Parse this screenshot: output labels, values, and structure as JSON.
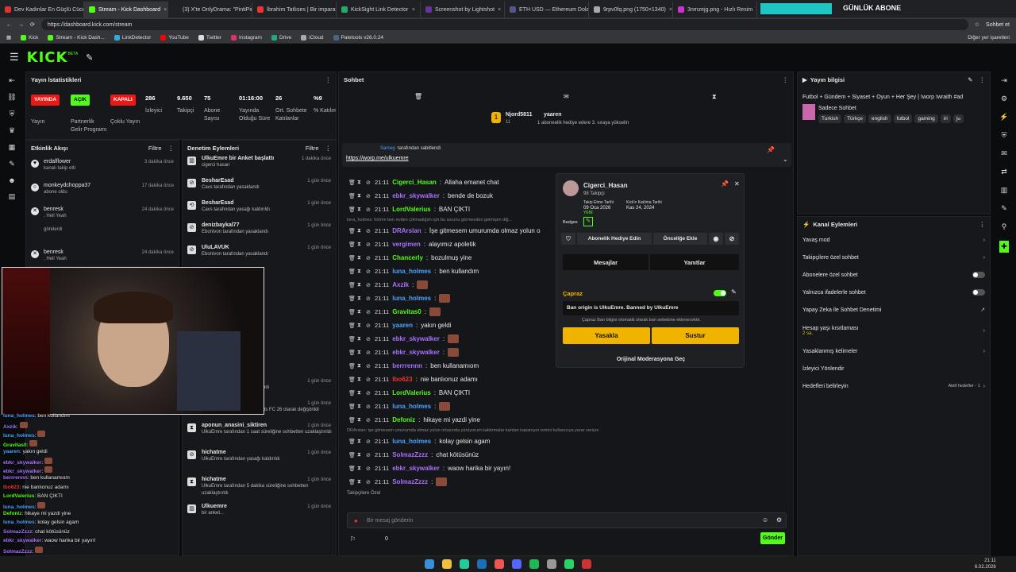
{
  "browser": {
    "tabs": [
      {
        "label": "Dev Kadınlar En Güçlü Cüceler",
        "color": "#d33"
      },
      {
        "label": "Stream - Kick Dashboard",
        "color": "#53fc18",
        "active": true
      },
      {
        "label": "(3) X'te OnlyDrama: \"PintiPir...",
        "color": "#222"
      },
      {
        "label": "İbrahim Tatlıses | Bir imparat...",
        "color": "#e33"
      },
      {
        "label": "KickSight Link Detector",
        "color": "#2a6"
      },
      {
        "label": "Screenshot by Lightshot",
        "color": "#639"
      },
      {
        "label": "ETH USD — Ethereum Dolar...",
        "color": "#558"
      },
      {
        "label": "9rpv0fq.png (1750×1340)",
        "color": "#aaa"
      },
      {
        "label": "3nmzejg.png - Hızlı Resim",
        "color": "#c3c"
      }
    ],
    "overlay_tag": "GÜNLÜK ABONE",
    "url": "https://dashboard.kick.com/stream",
    "profile_label": "Sohbet et",
    "bookmarks": [
      "Kick",
      "Stream - Kick Dash...",
      "LinkDetector",
      "YouTube",
      "Twitter",
      "Instagram",
      "Drive",
      "iCloud",
      "Paletools v26.0.24"
    ],
    "other_bookmarks": "Diğer yer işaretleri"
  },
  "brand": {
    "logo": "KICK",
    "logo_sup": "BETA"
  },
  "stats": {
    "title": "Yayın İstatistikleri",
    "items": [
      {
        "value": "YAYINDA",
        "label": "Yayın",
        "badge": "#e91916"
      },
      {
        "value": "AÇIK",
        "label": "Partnerlik Gelir Programı",
        "badge": "#53fc18"
      },
      {
        "value": "KAPALI",
        "label": "Çoklu Yayın",
        "badge": "#e91916"
      },
      {
        "value": "286",
        "label": "İzleyici"
      },
      {
        "value": "9.650",
        "label": "Takipçi"
      },
      {
        "value": "75",
        "label": "Abone Sayısı"
      },
      {
        "value": "01:16:00",
        "label": "Yayında Olduğu Süre"
      },
      {
        "value": "26",
        "label": "Ort. Sohbete Katılanlar"
      },
      {
        "value": "%9",
        "label": "% Katılım"
      }
    ]
  },
  "activity": {
    "title": "Etkinlik Akışı",
    "filter": "Filtre",
    "events": [
      {
        "name": "erdalflower",
        "sub": "kanalı takip etti",
        "time": "3 dakika önce"
      },
      {
        "name": "monkeydchoppa37",
        "sub": "abone oldu",
        "time": "17 dakika önce"
      },
      {
        "name": "benresk",
        "sub": ", Hell Yeah",
        "extra": "gönderdi",
        "time": "24 dakika önce"
      },
      {
        "name": "benresk",
        "sub": ", Hell Yeah",
        "extra": "gönderdi",
        "time": "24 dakika önce"
      }
    ]
  },
  "modlog": {
    "title": "Denetim Eylemleri",
    "filter": "Filtre",
    "items": [
      {
        "name": "UlkuEmre bir Anket başlattı",
        "sub": "cigerci hasan",
        "time": "1 dakika önce"
      },
      {
        "name": "BesharEsad",
        "sub": "Cavs tarafından yasaklandı",
        "time": "1 gün önce"
      },
      {
        "name": "BesharEsad",
        "sub": "Cavs tarafından yasağı kaldırıldı",
        "time": "1 gün önce"
      },
      {
        "name": "denizbaykal77",
        "sub": "Ebonivon tarafından yasaklandı",
        "time": "1 gün önce"
      },
      {
        "name": "UluLAVUK",
        "sub": "Ebonivon tarafından yasaklandı",
        "time": "1 gün önce"
      },
      {
        "name": "Ozonee",
        "sub": "UlkuEmre tarafından yasaklandı",
        "time": "1 gün önce"
      },
      {
        "name": "Kategori",
        "sub": "UlkuEmre tarafından EA Sports FC 26 olarak değiştirildi",
        "time": "1 gün önce"
      },
      {
        "name": "aponun_anasini_siktiren",
        "sub": "UlkuEmre tarafından 1 saat süreliğine sohbetten uzaklaştırıldı",
        "time": "1 gün önce"
      },
      {
        "name": "hichatme",
        "sub": "UlkuEmre tarafından yasağı kaldırıldı",
        "time": "1 gün önce"
      },
      {
        "name": "hichatme",
        "sub": "UlkuEmre tarafından 5 dakika süreliğine sohbetten uzaklaştırıldı",
        "time": "1 gün önce"
      },
      {
        "name": "Ulkuemre",
        "sub": "bir anket...",
        "time": "1 gün önce"
      }
    ]
  },
  "chat": {
    "title": "Sohbet",
    "gift_from": "Njord5811",
    "gift_to": "yaaren",
    "gift_count": "11",
    "gift_sub": "1 aboneelik hediye edere 3. sıraya yükselin",
    "pinned_by": "Sarney",
    "pinned_label": "tarafından sabitlendi",
    "pinned_link": "https://worp.me/ulkuemre",
    "lines": [
      {
        "time": "21:11",
        "user": "Cigerci_Hasan",
        "color": "#53fc18",
        "msg": "Allaha emanet chat"
      },
      {
        "time": "21:11",
        "user": "ebkr_skywalker",
        "color": "#a970ff",
        "msg": "bende de bozuk"
      },
      {
        "time": "21:11",
        "user": "LordValerius",
        "color": "#53fc18",
        "msg": "BAN ÇIKTI"
      },
      {
        "time": "21:11",
        "user": "DRArslan",
        "color": "#a970ff",
        "msg": "İşe gitmesem umurumda olmaz yolun o"
      },
      {
        "time": "21:11",
        "user": "vergimen",
        "color": "#a970ff",
        "msg": "alayımız apoletik"
      },
      {
        "time": "21:11",
        "user": "Chancerly",
        "color": "#53fc18",
        "msg": "bozulmuş yine"
      },
      {
        "time": "21:11",
        "user": "luna_holmes",
        "color": "#4aa3ff",
        "msg": "ben kullandım"
      },
      {
        "time": "21:11",
        "user": "Axzik",
        "color": "#a970ff",
        "msg": ""
      },
      {
        "time": "21:11",
        "user": "luna_holmes",
        "color": "#4aa3ff",
        "msg": ""
      },
      {
        "time": "21:11",
        "user": "Gravitas0",
        "color": "#53fc18",
        "msg": ""
      },
      {
        "time": "21:11",
        "user": "yaaren",
        "color": "#4aa3ff",
        "msg": "yakın geldi"
      },
      {
        "time": "21:11",
        "user": "ebkr_skywalker",
        "color": "#a970ff",
        "msg": ""
      },
      {
        "time": "21:11",
        "user": "ebkr_skywalker",
        "color": "#a970ff",
        "msg": ""
      },
      {
        "time": "21:11",
        "user": "berrrennn",
        "color": "#a970ff",
        "msg": "ben kullanamıom"
      },
      {
        "time": "21:11",
        "user": "Ibo623",
        "color": "#e33",
        "msg": "nie banlıonuz adamı"
      },
      {
        "time": "21:11",
        "user": "LordValerius",
        "color": "#53fc18",
        "msg": "BAN ÇIKTI"
      },
      {
        "time": "21:11",
        "user": "luna_holmes",
        "color": "#4aa3ff",
        "msg": ""
      },
      {
        "time": "21:11",
        "user": "Defoniz",
        "color": "#53fc18",
        "msg": "hikaye mi yazdi yine"
      },
      {
        "time": "21:11",
        "user": "luna_holmes",
        "color": "#4aa3ff",
        "msg": "kolay gelsin agam"
      },
      {
        "time": "21:11",
        "user": "SolmazZzzz",
        "color": "#a970ff",
        "msg": "chat kötüsünüz"
      },
      {
        "time": "21:11",
        "user": "ebkr_skywalker",
        "color": "#a970ff",
        "msg": "waow harika bir yayın!"
      },
      {
        "time": "21:11",
        "user": "SolmazZzzz",
        "color": "#a970ff",
        "msg": ""
      }
    ],
    "sys1": "luna_holmes: hömm ben evden çıkmadığım için bu sorunu görmezden gelmişim diğ...",
    "sys2": "DRArslan: işe gitmesem umurumda olmaz yolun ortasında yürüyorum kaldırmalar kardan kapanıyor ismini kullanıcıya yarar veriyor",
    "followers_only": "Takipçilere Özel",
    "input_placeholder": "Bir mesaj gönderin",
    "send": "Gönder",
    "count": "0"
  },
  "usercard": {
    "name": "Cigerci_Hasan",
    "followers": "98 Takipçi",
    "follow_label": "Takip Etme Tarihi",
    "follow_date": "09 Oca 2026",
    "join_label": "Kick'e Katılma Tarihi",
    "join_date": "Kas 24, 2024",
    "badges_label": "Badges",
    "new_label": "YENİ",
    "gift_btn": "Abonelik Hediye Edin",
    "priority_btn": "Önceliğe Ekle",
    "tab_messages": "Mesajlar",
    "tab_replies": "Yanıtlar",
    "cross_title": "Çapraz",
    "cross_msg": "Ban origin is UlkuEmre. Banned by UlkuEmre",
    "cross_note": "Çapraz Ban bilgisi otomatik olarak ban sebebine eklenecektir.",
    "ban_btn": "Yasakla",
    "timeout_btn": "Sustur",
    "orig_mod": "Orijinal Moderasyona Geç"
  },
  "streaminfo": {
    "title": "Yayın bilgisi",
    "stream_title": "Futbol + Gündem + Siyaset + Oyun + Her Şey | !worp !wraith #ad",
    "category": "Sadece Sohbet",
    "tags": [
      "Turkish",
      "Türkçe",
      "english",
      "futbol",
      "gaming",
      "iri",
      "ju"
    ]
  },
  "channel": {
    "title": "Kanal Eylemleri",
    "rows": [
      {
        "label": "Yavaş mod",
        "kind": "arrow"
      },
      {
        "label": "Takipçilere özel sohbet",
        "kind": "arrow"
      },
      {
        "label": "Abonelere özel sohbet",
        "kind": "toggle"
      },
      {
        "label": "Yalnızca ifadelerle sohbet",
        "kind": "toggle"
      },
      {
        "label": "Yapay Zeka ile Sohbet Denetimi",
        "kind": "ext"
      },
      {
        "label": "Hesap yaşı kısıtlaması",
        "sub": "2 sa.",
        "kind": "arrow"
      },
      {
        "label": "Yasaklanmış kelimeler",
        "kind": "arrow"
      },
      {
        "label": "İzleyici Yönlendir",
        "kind": "none"
      },
      {
        "label": "Hedefleri belirleyin",
        "right": "Aktif hedefler - 1",
        "kind": "arrow"
      }
    ]
  },
  "overlay_chat": [
    {
      "user": "luna_holmes",
      "msg": "ben kullandım",
      "color": "#4aa3ff"
    },
    {
      "user": "Axzik",
      "msg": "",
      "color": "#a970ff"
    },
    {
      "user": "luna_holmes",
      "msg": "",
      "color": "#4aa3ff"
    },
    {
      "user": "Gravitas0",
      "msg": "",
      "color": "#53fc18"
    },
    {
      "user": "yaaren",
      "msg": "yakın geldi",
      "color": "#4aa3ff"
    },
    {
      "user": "ebkr_skywalker",
      "msg": "",
      "color": "#a970ff"
    },
    {
      "user": "ebkr_skywalker",
      "msg": "",
      "color": "#a970ff"
    },
    {
      "user": "berrrennn",
      "msg": "ben kullanamıom",
      "color": "#a970ff"
    },
    {
      "user": "Ibo623",
      "msg": "nie banlıonuz adamı",
      "color": "#e33"
    },
    {
      "user": "LordValerius",
      "msg": "BAN ÇIKTI",
      "color": "#53fc18"
    },
    {
      "user": "luna_holmes",
      "msg": "",
      "color": "#4aa3ff"
    },
    {
      "user": "Defoniz",
      "msg": "hikaye mi yazdi yine",
      "color": "#53fc18"
    },
    {
      "user": "luna_holmes",
      "msg": "kolay gelsin agam",
      "color": "#4aa3ff"
    },
    {
      "user": "SolmazZzzz",
      "msg": "chat kötüsünüz",
      "color": "#a970ff"
    },
    {
      "user": "ebkr_skywalker",
      "msg": "waow harika bir yayın!",
      "color": "#a970ff"
    },
    {
      "user": "SolmazZzzz",
      "msg": "",
      "color": "#a970ff"
    }
  ],
  "taskbar": {
    "time": "21:11",
    "date": "6.02.2026"
  }
}
